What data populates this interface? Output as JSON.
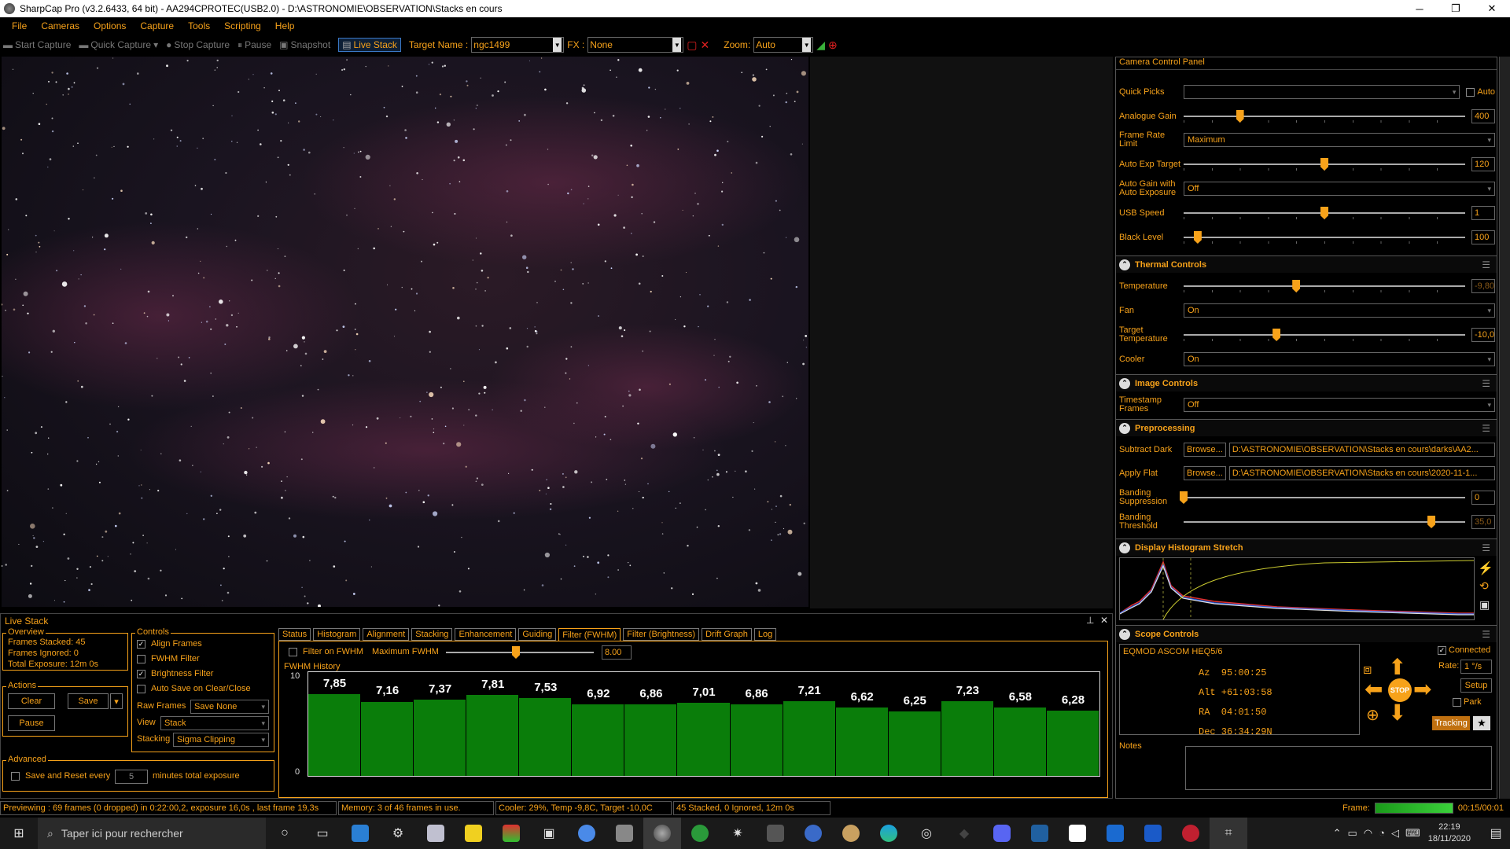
{
  "title": "SharpCap Pro (v3.2.6433, 64 bit) - AA294CPROTEC(USB2.0) - D:\\ASTRONOMIE\\OBSERVATION\\Stacks en cours",
  "window": {
    "min": "─",
    "max": "❐",
    "close": "✕"
  },
  "menu": [
    "File",
    "Cameras",
    "Options",
    "Capture",
    "Tools",
    "Scripting",
    "Help"
  ],
  "toolbar": {
    "start_capture": "Start Capture",
    "quick_capture": "Quick Capture",
    "stop_capture": "Stop Capture",
    "pause": "Pause",
    "snapshot": "Snapshot",
    "live_stack": "Live Stack",
    "target_label": "Target Name :",
    "target_value": "ngc1499",
    "fx_label": "FX :",
    "fx_value": "None",
    "zoom_label": "Zoom:",
    "zoom_value": "Auto"
  },
  "ccp": {
    "title": "Camera Control Panel",
    "quick_picks": "Quick Picks",
    "auto": "Auto",
    "analogue_gain": {
      "label": "Analogue Gain",
      "value": "400",
      "pos": 0.2
    },
    "frame_rate": {
      "label": "Frame Rate Limit",
      "value": "Maximum"
    },
    "auto_exp": {
      "label": "Auto Exp Target",
      "value": "120",
      "pos": 0.5
    },
    "auto_gain": {
      "label": "Auto Gain with Auto Exposure",
      "value": "Off"
    },
    "usb_speed": {
      "label": "USB Speed",
      "value": "1",
      "pos": 0.5
    },
    "black_level": {
      "label": "Black Level",
      "value": "100",
      "pos": 0.05
    },
    "thermal": "Thermal Controls",
    "temperature": {
      "label": "Temperature",
      "value": "-9,80",
      "pos": 0.4
    },
    "fan": {
      "label": "Fan",
      "value": "On"
    },
    "target_temp": {
      "label": "Target Temperature",
      "value": "-10,0",
      "pos": 0.33
    },
    "cooler": {
      "label": "Cooler",
      "value": "On"
    },
    "image_controls": "Image Controls",
    "timestamp": {
      "label": "Timestamp Frames",
      "value": "Off"
    },
    "preprocessing": "Preprocessing",
    "subtract_dark": {
      "label": "Subtract Dark",
      "browse": "Browse...",
      "path": "D:\\ASTRONOMIE\\OBSERVATION\\Stacks en cours\\darks\\AA2..."
    },
    "apply_flat": {
      "label": "Apply Flat",
      "browse": "Browse...",
      "path": "D:\\ASTRONOMIE\\OBSERVATION\\Stacks en cours\\2020-11-1..."
    },
    "banding_supp": {
      "label": "Banding Suppression",
      "value": "0",
      "pos": 0.0
    },
    "banding_thr": {
      "label": "Banding Threshold",
      "value": "35,0",
      "pos": 0.88
    },
    "histogram": "Display Histogram Stretch",
    "scope": "Scope Controls",
    "scope_name": "EQMOD ASCOM HEQ5/6",
    "connected": "Connected",
    "az": "Az  95:00:25",
    "alt": "Alt +61:03:58",
    "ra": "RA  04:01:50",
    "dec": "Dec 36:34:29N",
    "rate_label": "Rate:",
    "rate_value": "1 °/s",
    "setup": "Setup",
    "park": "Park",
    "tracking": "Tracking",
    "stop": "STOP",
    "notes": "Notes"
  },
  "livestack": {
    "title": "Live Stack",
    "overview": "Overview",
    "frames_stacked": "Frames Stacked:  45",
    "frames_ignored": "Frames Ignored:  0",
    "total_exposure": "Total Exposure:   12m 0s",
    "actions": "Actions",
    "clear": "Clear",
    "save": "Save",
    "pause": "Pause",
    "advanced": "Advanced",
    "save_reset": "Save and Reset every",
    "minutes": "5",
    "minutes_label": "minutes total exposure",
    "controls": "Controls",
    "align": "Align Frames",
    "fwhm_filter": "FWHM Filter",
    "brightness": "Brightness Filter",
    "autosave": "Auto Save on Clear/Close",
    "raw_label": "Raw Frames",
    "raw_value": "Save None",
    "view_label": "View",
    "view_value": "Stack",
    "stacking_label": "Stacking",
    "stacking_value": "Sigma Clipping",
    "tabs": [
      "Status",
      "Histogram",
      "Alignment",
      "Stacking",
      "Enhancement",
      "Guiding",
      "Filter (FWHM)",
      "Filter (Brightness)",
      "Drift Graph",
      "Log"
    ],
    "filter_on": "Filter on FWHM",
    "max_fwhm": "Maximum FWHM",
    "max_value": "8.00",
    "history": "FWHM History",
    "ymax": "10",
    "ymin": "0"
  },
  "chart_data": {
    "type": "bar",
    "title": "FWHM History",
    "ylim": [
      0,
      10
    ],
    "values": [
      7.85,
      7.16,
      7.37,
      7.81,
      7.53,
      6.92,
      6.86,
      7.01,
      6.86,
      7.21,
      6.62,
      6.25,
      7.23,
      6.58,
      6.28
    ],
    "labels": [
      "7,85",
      "7,16",
      "7,37",
      "7,81",
      "7,53",
      "6,92",
      "6,86",
      "7,01",
      "6,86",
      "7,21",
      "6,62",
      "6,25",
      "7,23",
      "6,58",
      "6,28"
    ],
    "bar_color": "#0a7d0a"
  },
  "status": {
    "preview": "Previewing : 69 frames (0 dropped) in 0:22:00,2, exposure 16,0s , last frame 19,3s",
    "memory": "Memory: 3 of 46 frames in use.",
    "cooler": "Cooler: 29%, Temp -9,8C, Target -10,0C",
    "stacked": "45 Stacked, 0 Ignored, 12m 0s",
    "frame_label": "Frame:",
    "frame_time": "00:15/00:01"
  },
  "taskbar": {
    "search": "Taper ici pour rechercher",
    "time": "22:19",
    "date": "18/11/2020"
  }
}
